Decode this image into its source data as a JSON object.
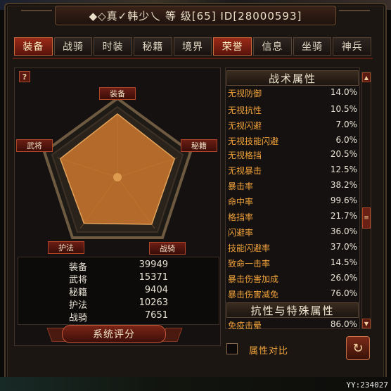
{
  "title": "◆◇真✓韩少乀 等 级[65] ID[28000593]",
  "tabs": [
    {
      "label": "装备",
      "active": true
    },
    {
      "label": "战骑",
      "active": false
    },
    {
      "label": "时装",
      "active": false
    },
    {
      "label": "秘籍",
      "active": false
    },
    {
      "label": "境界",
      "active": false
    },
    {
      "label": "荣誉",
      "active": true
    },
    {
      "label": "信息",
      "active": false
    },
    {
      "label": "坐骑",
      "active": false
    },
    {
      "label": "神兵",
      "active": false
    }
  ],
  "help_label": "?",
  "radar": {
    "axes": [
      "装备",
      "秘籍",
      "战骑",
      "护法",
      "武将"
    ],
    "values": [
      1.0,
      0.95,
      0.92,
      0.9,
      0.95
    ]
  },
  "stats": [
    {
      "label": "装备",
      "value": "39949"
    },
    {
      "label": "武将",
      "value": "15371"
    },
    {
      "label": "秘籍",
      "value": "9404"
    },
    {
      "label": "护法",
      "value": "10263"
    },
    {
      "label": "战骑",
      "value": "7651"
    }
  ],
  "rating_button": "系统评分",
  "section_tactics": "战术属性",
  "tactics": [
    {
      "label": "无视防御",
      "value": "14.0%"
    },
    {
      "label": "无视抗性",
      "value": "10.5%"
    },
    {
      "label": "无视闪避",
      "value": "7.0%"
    },
    {
      "label": "无视技能闪避",
      "value": "6.0%"
    },
    {
      "label": "无视格挡",
      "value": "20.5%"
    },
    {
      "label": "无视暴击",
      "value": "12.5%"
    },
    {
      "label": "暴击率",
      "value": "38.2%"
    },
    {
      "label": "命中率",
      "value": "99.6%"
    },
    {
      "label": "格挡率",
      "value": "21.7%"
    },
    {
      "label": "闪避率",
      "value": "36.0%"
    },
    {
      "label": "技能闪避率",
      "value": "37.0%"
    },
    {
      "label": "致命一击率",
      "value": "14.5%"
    },
    {
      "label": "暴击伤害加成",
      "value": "26.0%"
    },
    {
      "label": "暴击伤害减免",
      "value": "76.0%"
    }
  ],
  "section_resist": "抗性与特殊属性",
  "resist": [
    {
      "label": "免疫击晕",
      "value": "86.0%"
    }
  ],
  "compare_label": "属性对比",
  "return_icon": "↻",
  "footer": "YY:234027",
  "scroll_thumb": "≡",
  "colors": {
    "accent": "#f2a33a",
    "tab_active": "#9a2a18",
    "radar_fill": "#b36a2a"
  }
}
